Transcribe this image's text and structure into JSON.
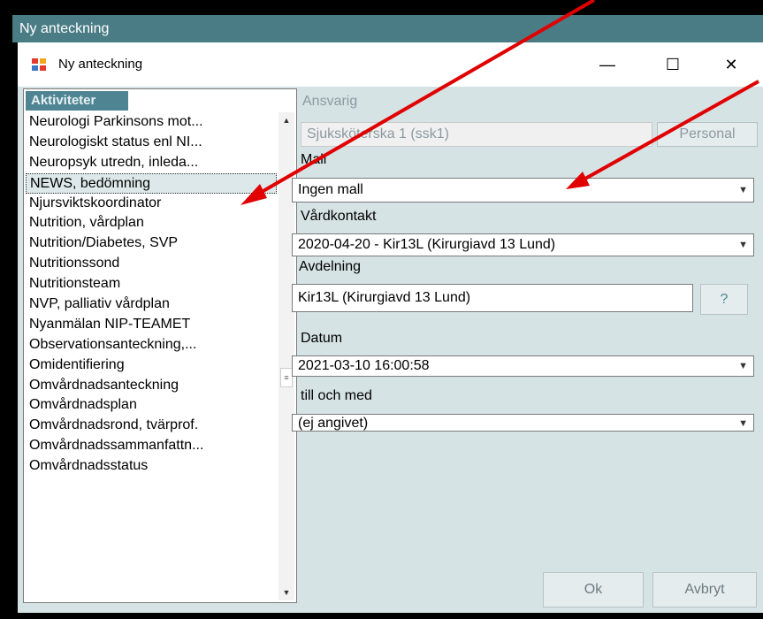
{
  "outer_window": {
    "title": "Ny anteckning"
  },
  "dialog": {
    "title": "Ny anteckning",
    "controls": {
      "minimize": "—",
      "maximize": "☐",
      "close": "✕"
    }
  },
  "activities": {
    "header": "Aktiviteter",
    "items": [
      "Neurologi Parkinsons mot...",
      "Neurologiskt status enl NI...",
      "Neuropsyk utredn, inleda...",
      "NEWS, bedömning",
      "Njursviktskoordinator",
      "Nutrition, vårdplan",
      "Nutrition/Diabetes, SVP",
      "Nutritionssond",
      "Nutritionsteam",
      "NVP, palliativ vårdplan",
      "Nyanmälan NIP-TEAMET",
      "Observationsanteckning,...",
      "Omidentifiering",
      "Omvårdnadsanteckning",
      "Omvårdnadsplan",
      "Omvårdnadsrond, tvärprof.",
      "Omvårdnadssammanfattn...",
      "Omvårdnadsstatus"
    ],
    "selected_index": 3
  },
  "form": {
    "ansvarig_label": "Ansvarig",
    "ansvarig_value": "Sjuksköterska 1 (ssk1)",
    "personal_button": "Personal",
    "mall_label": "Mall",
    "mall_value": "Ingen mall",
    "vardkontakt_label": "Vårdkontakt",
    "vardkontakt_value": "2020-04-20 -  Kir13L (Kirurgiavd 13 Lund)",
    "avdelning_label": "Avdelning",
    "avdelning_value": "Kir13L (Kirurgiavd 13 Lund)",
    "help_button": "?",
    "datum_label": "Datum",
    "datum_value": "2021-03-10 16:00:58",
    "till_label": "till och med",
    "till_value": "(ej angivet)"
  },
  "buttons": {
    "ok": "Ok",
    "cancel": "Avbryt"
  },
  "colors": {
    "accent": "#4f8592",
    "annotation_arrow": "#e00000",
    "client_bg": "#d6e3e5"
  }
}
